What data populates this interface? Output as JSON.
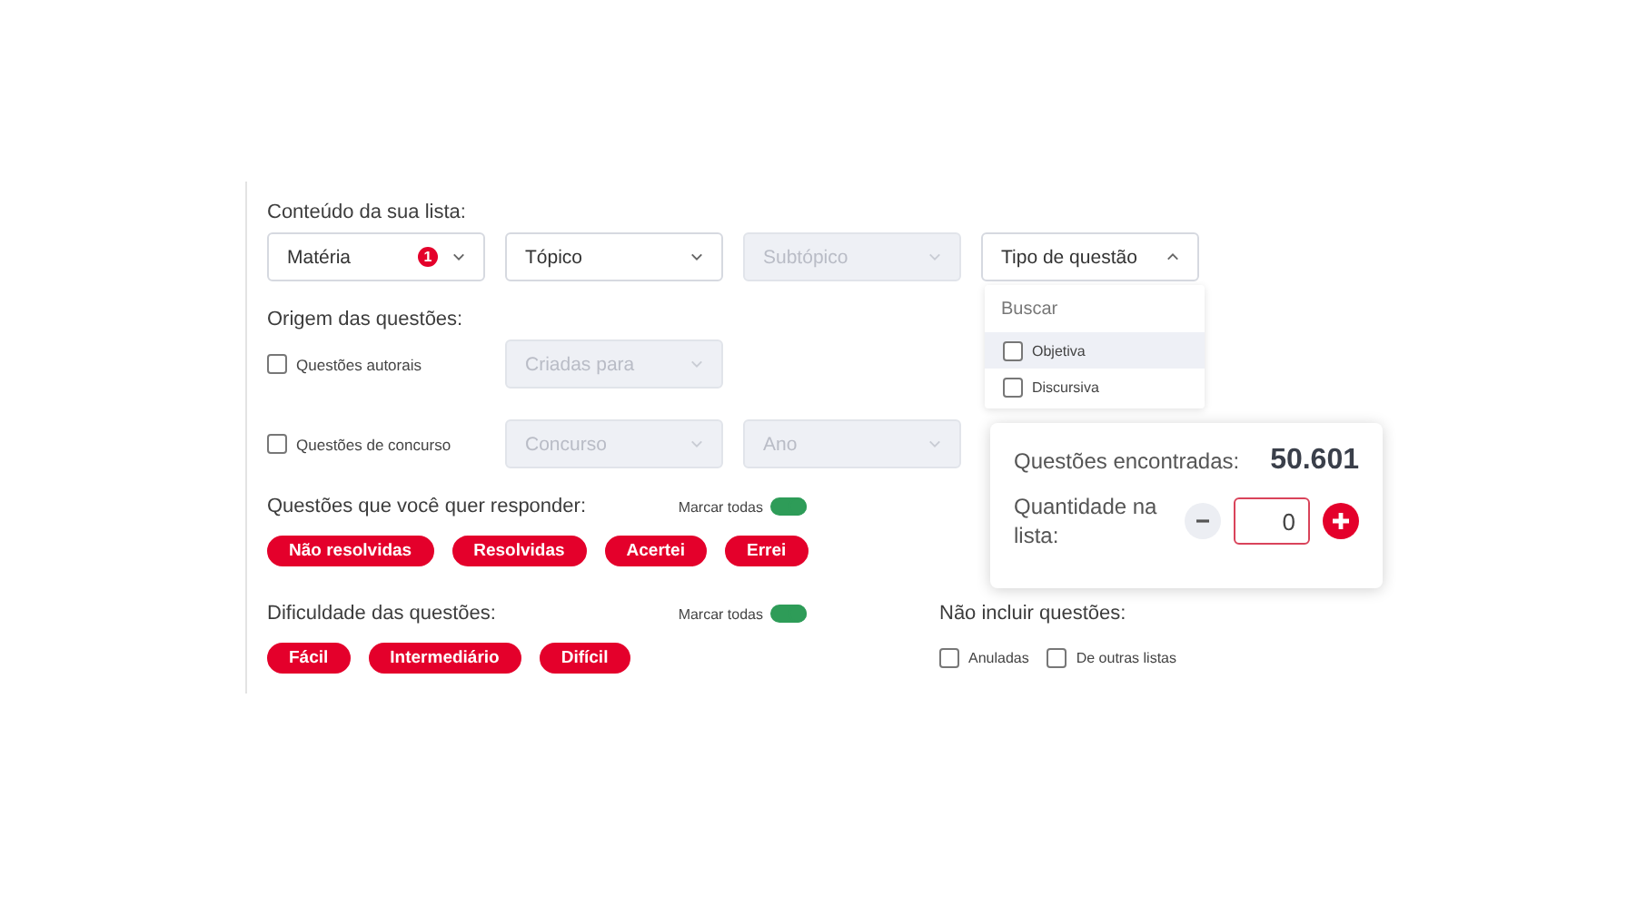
{
  "content": {
    "label": "Conteúdo da sua lista:",
    "selects": [
      {
        "label": "Matéria",
        "disabled": false,
        "badge": "1",
        "expanded": false
      },
      {
        "label": "Tópico",
        "disabled": false,
        "expanded": false
      },
      {
        "label": "Subtópico",
        "disabled": true,
        "expanded": false
      },
      {
        "label": "Tipo de questão",
        "disabled": false,
        "expanded": true
      }
    ]
  },
  "dropdown": {
    "placeholder": "Buscar",
    "options": [
      {
        "label": "Objetiva",
        "checked": false,
        "highlighted": true
      },
      {
        "label": "Discursiva",
        "checked": false,
        "highlighted": false
      }
    ]
  },
  "origin": {
    "label": "Origem das questões:",
    "rows": [
      {
        "label": "Questões autorais",
        "checked": false,
        "selects": [
          {
            "label": "Criadas para",
            "disabled": true
          }
        ]
      },
      {
        "label": "Questões de concurso",
        "checked": false,
        "selects": [
          {
            "label": "Concurso",
            "disabled": true
          },
          {
            "label": "Ano",
            "disabled": true
          }
        ]
      }
    ]
  },
  "answer": {
    "label": "Questões que você quer responder:",
    "toggle_label": "Marcar todas",
    "toggle_on": true,
    "chips": [
      {
        "label": "Não resolvidas",
        "selected": true
      },
      {
        "label": "Resolvidas",
        "selected": true
      },
      {
        "label": "Acertei",
        "selected": true
      },
      {
        "label": "Errei",
        "selected": true
      }
    ]
  },
  "difficulty": {
    "label": "Dificuldade das questões:",
    "toggle_label": "Marcar todas",
    "toggle_on": true,
    "chips": [
      {
        "label": "Fácil",
        "selected": true
      },
      {
        "label": "Intermediário",
        "selected": true
      },
      {
        "label": "Difícil",
        "selected": true
      }
    ]
  },
  "exclude": {
    "label": "Não incluir questões:",
    "options": [
      {
        "label": "Anuladas",
        "checked": false
      },
      {
        "label": "De outras listas",
        "checked": false
      }
    ]
  },
  "summary": {
    "found_label": "Questões encontradas:",
    "found_value": "50.601",
    "quantity_label": "Quantidade na lista:",
    "quantity_value": "0"
  }
}
